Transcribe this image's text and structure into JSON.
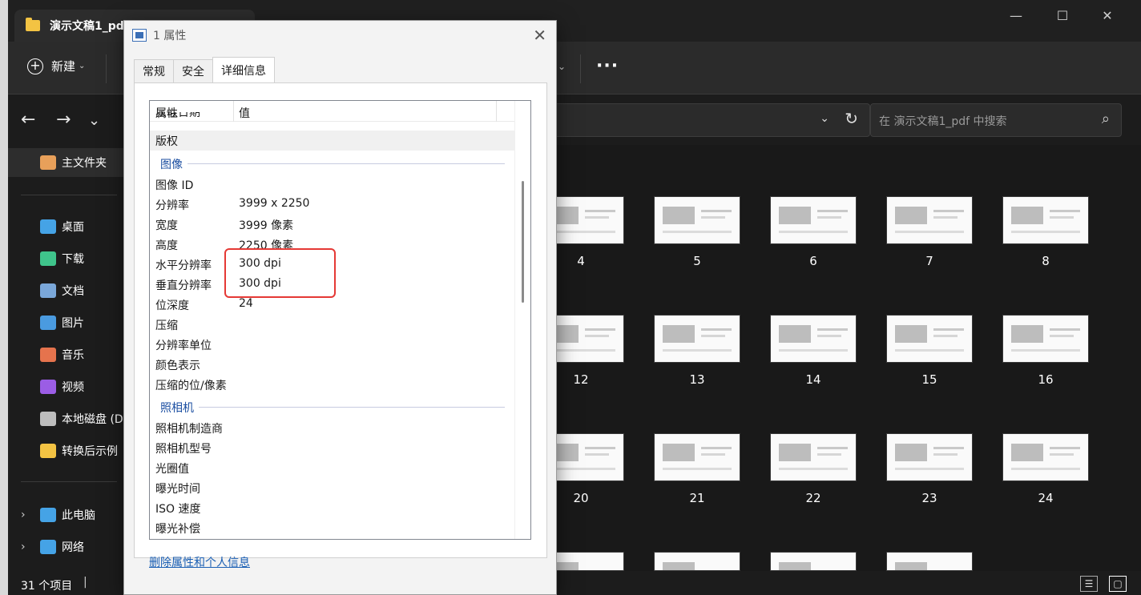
{
  "explorer": {
    "tab_title": "演示文稿1_pdf",
    "new_label": "新建",
    "search_placeholder": "在 演示文稿1_pdf 中搜索",
    "status": "31 个项目",
    "sidebar": [
      {
        "label": "主文件夹",
        "icon": "home-icon",
        "color": "#e8a05a"
      },
      {
        "label": "桌面",
        "icon": "desktop-icon",
        "color": "#45a3e6"
      },
      {
        "label": "下载",
        "icon": "download-icon",
        "color": "#3fc48b"
      },
      {
        "label": "文档",
        "icon": "document-icon",
        "color": "#7aa7d9"
      },
      {
        "label": "图片",
        "icon": "pictures-icon",
        "color": "#4a9be0"
      },
      {
        "label": "音乐",
        "icon": "music-icon",
        "color": "#e5734d"
      },
      {
        "label": "视频",
        "icon": "video-icon",
        "color": "#9b5de5"
      },
      {
        "label": "本地磁盘 (D",
        "icon": "drive-icon",
        "color": "#bdbdbd"
      },
      {
        "label": "转换后示例",
        "icon": "folder-icon",
        "color": "#f3c343"
      },
      {
        "label": "此电脑",
        "icon": "computer-icon",
        "color": "#45a3e6"
      },
      {
        "label": "网络",
        "icon": "network-icon",
        "color": "#45a3e6"
      }
    ],
    "thumbnails": {
      "row1": [
        "4",
        "5",
        "6",
        "7",
        "8"
      ],
      "row2": [
        "12",
        "13",
        "14",
        "15",
        "16"
      ],
      "row3": [
        "20",
        "21",
        "22",
        "23",
        "24"
      ]
    }
  },
  "dialog": {
    "title": "1 属性",
    "tabs": [
      "常规",
      "安全",
      "详细信息"
    ],
    "header": {
      "name": "属性",
      "value": "值"
    },
    "clipped_row": "获取日期",
    "rows": [
      {
        "name": "版权",
        "value": ""
      },
      {
        "group": "图像"
      },
      {
        "name": "图像 ID",
        "value": ""
      },
      {
        "name": "分辨率",
        "value": "3999 x 2250"
      },
      {
        "name": "宽度",
        "value": "3999 像素"
      },
      {
        "name": "高度",
        "value": "2250 像素"
      },
      {
        "name": "水平分辨率",
        "value": "300 dpi"
      },
      {
        "name": "垂直分辨率",
        "value": "300 dpi"
      },
      {
        "name": "位深度",
        "value": "24"
      },
      {
        "name": "压缩",
        "value": ""
      },
      {
        "name": "分辨率单位",
        "value": ""
      },
      {
        "name": "颜色表示",
        "value": ""
      },
      {
        "name": "压缩的位/像素",
        "value": ""
      },
      {
        "group": "照相机"
      },
      {
        "name": "照相机制造商",
        "value": ""
      },
      {
        "name": "照相机型号",
        "value": ""
      },
      {
        "name": "光圈值",
        "value": ""
      },
      {
        "name": "曝光时间",
        "value": ""
      },
      {
        "name": "ISO 速度",
        "value": ""
      },
      {
        "name": "曝光补偿",
        "value": ""
      }
    ],
    "link": "删除属性和个人信息",
    "highlight_color": "#e53935"
  }
}
